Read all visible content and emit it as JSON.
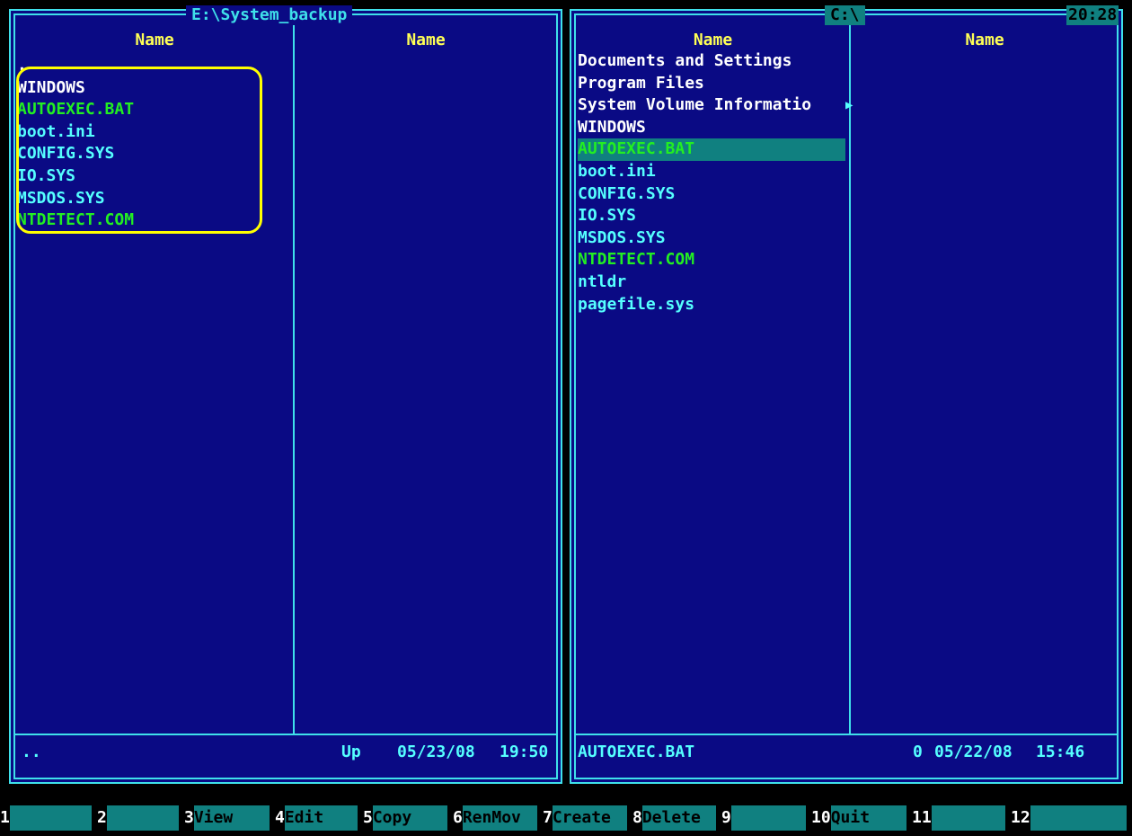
{
  "left_panel": {
    "path": "E:\\System_backup",
    "column_headers": [
      "Name",
      "Name"
    ],
    "files": [
      {
        "name": ".",
        "color": "white"
      },
      {
        "name": "WINDOWS",
        "color": "white"
      },
      {
        "name": "AUTOEXEC.BAT",
        "color": "green"
      },
      {
        "name": "boot.ini",
        "color": "cyan"
      },
      {
        "name": "CONFIG.SYS",
        "color": "cyan"
      },
      {
        "name": "IO.SYS",
        "color": "cyan"
      },
      {
        "name": "MSDOS.SYS",
        "color": "cyan"
      },
      {
        "name": "NTDETECT.COM",
        "color": "green"
      }
    ],
    "status": {
      "name": "..",
      "size": "Up",
      "date": "05/23/08",
      "time": "19:50"
    }
  },
  "right_panel": {
    "path": "C:\\",
    "clock": "20:28",
    "column_headers": [
      "Name",
      "Name"
    ],
    "files": [
      {
        "name": "Documents and Settings",
        "color": "white"
      },
      {
        "name": "Program Files",
        "color": "white"
      },
      {
        "name": "System Volume Informatio",
        "color": "white",
        "truncated": true
      },
      {
        "name": "WINDOWS",
        "color": "white"
      },
      {
        "name": "AUTOEXEC.BAT",
        "color": "green",
        "selected": true
      },
      {
        "name": "boot.ini",
        "color": "cyan"
      },
      {
        "name": "CONFIG.SYS",
        "color": "cyan"
      },
      {
        "name": "IO.SYS",
        "color": "cyan"
      },
      {
        "name": "MSDOS.SYS",
        "color": "cyan"
      },
      {
        "name": "NTDETECT.COM",
        "color": "green"
      },
      {
        "name": "ntldr",
        "color": "cyan"
      },
      {
        "name": "pagefile.sys",
        "color": "cyan"
      }
    ],
    "status": {
      "name": "AUTOEXEC.BAT",
      "size": "0",
      "date": "05/22/08",
      "time": "15:46"
    }
  },
  "function_keys": [
    {
      "num": "1",
      "label": ""
    },
    {
      "num": "2",
      "label": ""
    },
    {
      "num": "3",
      "label": "View"
    },
    {
      "num": "4",
      "label": "Edit"
    },
    {
      "num": "5",
      "label": "Copy"
    },
    {
      "num": "6",
      "label": "RenMov"
    },
    {
      "num": "7",
      "label": "Create"
    },
    {
      "num": "8",
      "label": "Delete"
    },
    {
      "num": "9",
      "label": ""
    },
    {
      "num": "10",
      "label": "Quit"
    },
    {
      "num": "11",
      "label": ""
    },
    {
      "num": "12",
      "label": ""
    }
  ],
  "colors": {
    "panel_bg": "#0a0a84",
    "frame": "#3fe0ea",
    "header": "#ffff55",
    "dir": "#ffffff",
    "file": "#55ffff",
    "exec": "#22ee22",
    "selection": "#108080",
    "annotation_ring": "#ffff00"
  }
}
